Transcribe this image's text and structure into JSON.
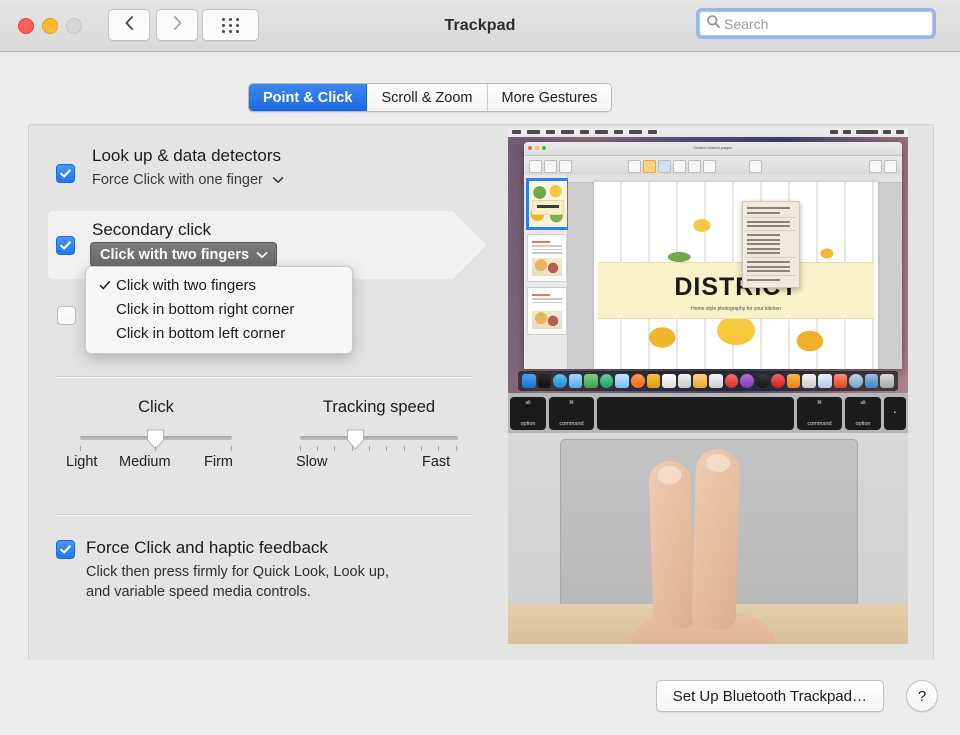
{
  "window": {
    "title": "Trackpad",
    "traffic_lights": [
      "close",
      "minimize",
      "zoom"
    ]
  },
  "toolbar": {
    "back_icon": "chevron-left-icon",
    "forward_icon": "chevron-right-icon",
    "grid_icon": "show-all-grid-icon",
    "search": {
      "placeholder": "Search",
      "value": "",
      "icon": "search-icon",
      "focused": true
    }
  },
  "tabs": [
    {
      "label": "Point & Click",
      "active": true
    },
    {
      "label": "Scroll & Zoom",
      "active": false
    },
    {
      "label": "More Gestures",
      "active": false
    }
  ],
  "settings": {
    "lookup": {
      "label": "Look up & data detectors",
      "option_label": "Force Click with one finger",
      "checked": true,
      "chevron": "chevron-down-icon"
    },
    "secondary_click": {
      "label": "Secondary click",
      "selected_option": "Click with two fingers",
      "checked": true,
      "chevron": "chevron-down-icon",
      "highlighted": true,
      "menu_open": true,
      "menu_options": [
        {
          "label": "Click with two fingers",
          "checked": true
        },
        {
          "label": "Click in bottom right corner",
          "checked": false
        },
        {
          "label": "Click in bottom left corner",
          "checked": false
        }
      ]
    },
    "tap_to_click": {
      "checked": false
    },
    "force_click": {
      "label": "Force Click and haptic feedback",
      "description_line1": "Click then press firmly for Quick Look, Look up,",
      "description_line2": "and variable speed media controls.",
      "checked": true
    }
  },
  "sliders": {
    "click": {
      "title": "Click",
      "labels": [
        "Light",
        "Medium",
        "Firm"
      ],
      "value_label": "Medium",
      "position_percent": 50,
      "tick_count": 3
    },
    "tracking_speed": {
      "title": "Tracking speed",
      "labels": [
        "Slow",
        "Fast"
      ],
      "position_percent": 34,
      "tick_count": 10
    }
  },
  "preview": {
    "description": "Video demonstration of two-finger secondary click on a MacBook trackpad",
    "document_title": "District Market.pages",
    "document_headline": "DISTRICT",
    "document_subtitle": "Home style photography for your kitchen",
    "keys": [
      {
        "top": "alt",
        "bottom": "option"
      },
      {
        "top": "⌘",
        "bottom": "command"
      },
      {
        "top": "",
        "bottom": ""
      },
      {
        "top": "⌘",
        "bottom": "command"
      },
      {
        "top": "alt",
        "bottom": "option"
      },
      {
        "top": "",
        "bottom": "▪"
      }
    ]
  },
  "footer": {
    "setup_button": "Set Up Bluetooth Trackpad…",
    "help_button": "?",
    "help_icon": "question-mark-icon"
  },
  "colors": {
    "accent_blue": "#2176ed",
    "tab_active": "#1a68e4",
    "focus_ring": "#93b6ef",
    "popup_active": "#6e6e6e"
  }
}
